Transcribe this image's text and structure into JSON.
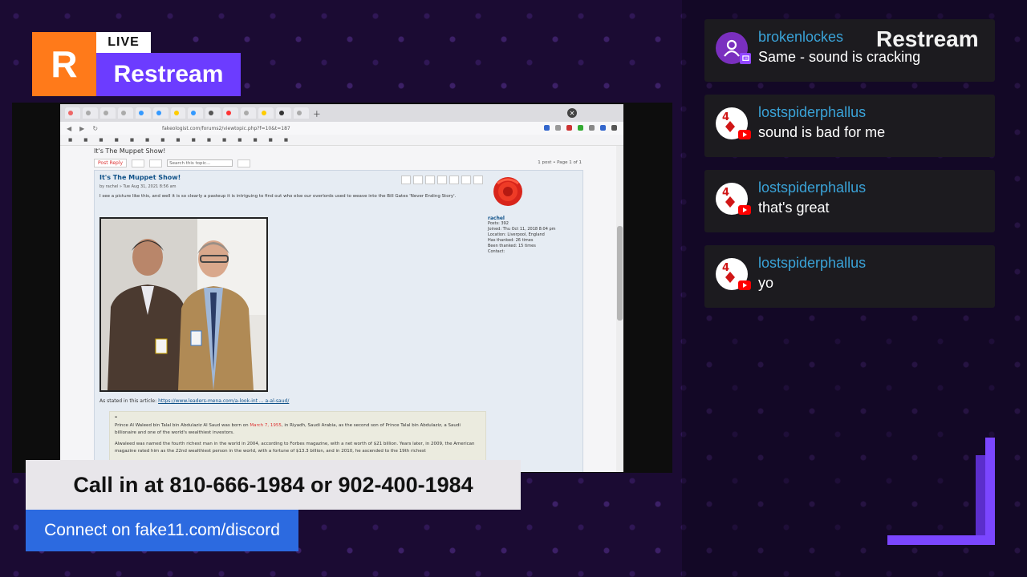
{
  "overlay": {
    "logo_letter": "R",
    "live_label": "LIVE",
    "brand": "Restream",
    "watermark": "Restream",
    "call_in": "Call in at 810-666-1984 or 902-400-1984",
    "discord": "Connect on fake11.com/discord",
    "colors": {
      "orange": "#ff7a1a",
      "purple": "#6c3cff",
      "discord_blue": "#2c6ae0",
      "chat_name": "#3aa3d8"
    }
  },
  "browser": {
    "url": "fakeologist.com/forums2/viewtopic.php?f=10&t=187",
    "partial_heading": "It's The Muppet Show!",
    "post_reply": "Post Reply",
    "search_placeholder": "Search this topic...",
    "pagination": "1 post • Page 1 of 1",
    "post": {
      "title": "It's The Muppet Show!",
      "meta": "by rachel » Tue Aug 31, 2021 8:56 am",
      "body": "I see a picture like this, and well it is so clearly a pasteup it is intriguing to find out who else our overlords used to weave into the Bill Gates 'Never Ending Story'.",
      "link_prefix": "As stated in this article:",
      "link_text": "https://www.leaders-mena.com/a-look-int ... a-al-saud/",
      "quote_mark": "❝",
      "quote_before_date": "Prince Al Waleed bin Talal bin Abdulaziz Al Saud was born on ",
      "quote_date": "March 7, 1955",
      "quote_after_date": ", in Riyadh, Saudi Arabia, as the second son of Prince Talal bin Abdulaziz, a Saudi billionaire and one of the world's wealthiest investors.",
      "quote_p2": "Alwaleed was named the fourth richest man in the world in 2004, according to Forbes magazine, with a net worth of $21 billion. Years later, in 2009, the American magazine rated him as the 22nd wealthiest person in the world, with a fortune of $13.3 billion, and in 2010, he ascended to the 19th richest"
    },
    "profile": {
      "username": "rachel",
      "posts": "Posts: 392",
      "joined": "Joined: Thu Oct 11, 2018 8:04 pm",
      "location": "Location: Liverpool, England",
      "has_thanked": "Has thanked: 26 times",
      "been_thanked": "Been thanked: 15 times",
      "contact": "Contact:"
    }
  },
  "chat": [
    {
      "name": "brokenlockes",
      "text": "Same - sound is cracking",
      "platform": "twitch"
    },
    {
      "name": "lostspiderphallus",
      "text": "sound is bad for me",
      "platform": "youtube"
    },
    {
      "name": "lostspiderphallus",
      "text": "that's great",
      "platform": "youtube"
    },
    {
      "name": "lostspiderphallus",
      "text": "yo",
      "platform": "youtube"
    }
  ]
}
